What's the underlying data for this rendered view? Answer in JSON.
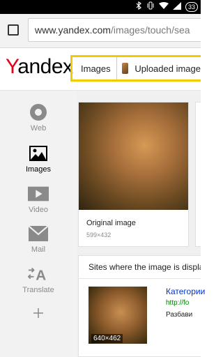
{
  "status_bar": {
    "battery_level": "33"
  },
  "browser": {
    "url_host": "www.yandex.com",
    "url_path": "/images/touch/sea"
  },
  "header": {
    "logo": {
      "initial": "Y",
      "rest": "andex"
    },
    "search": {
      "tab_label": "Images",
      "uploaded_label": "Uploaded image"
    }
  },
  "sidebar": {
    "items": [
      {
        "label": "Web",
        "icon": "web-icon"
      },
      {
        "label": "Images",
        "icon": "images-icon"
      },
      {
        "label": "Video",
        "icon": "video-icon"
      },
      {
        "label": "Mail",
        "icon": "mail-icon"
      },
      {
        "label": "Translate",
        "icon": "translate-icon"
      },
      {
        "label": "",
        "icon": "plus-icon"
      }
    ]
  },
  "main": {
    "original_card": {
      "title": "Original image",
      "dimensions": "599×432"
    },
    "sites_section": {
      "heading": "Sites where the image is displayed",
      "result": {
        "title": "Категории",
        "url": "http://fo",
        "snippet": "Разбави",
        "image_size": "640×462"
      }
    }
  }
}
